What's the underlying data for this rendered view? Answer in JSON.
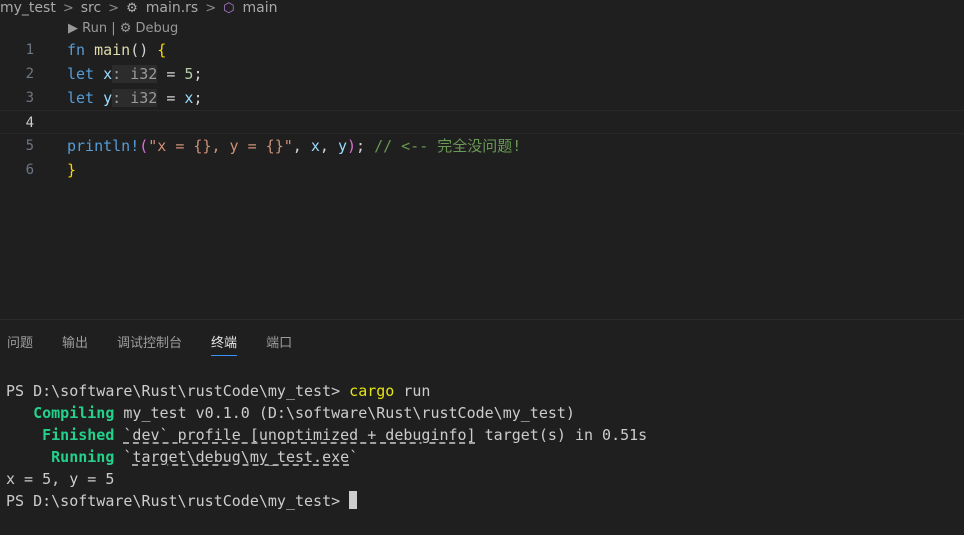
{
  "breadcrumb": {
    "items": [
      "my_test",
      "src",
      "main.rs",
      "main"
    ]
  },
  "codelens": {
    "run": "▶ Run",
    "separator": " | ",
    "debug": "⚙ Debug"
  },
  "editor": {
    "line_numbers": [
      "1",
      "2",
      "3",
      "4",
      "5",
      "6"
    ],
    "lines": [
      [
        {
          "t": "fn",
          "c": "kw"
        },
        {
          "t": " ",
          "c": "plain"
        },
        {
          "t": "main",
          "c": "fn"
        },
        {
          "t": "()",
          "c": "plain"
        },
        {
          "t": " {",
          "c": "brace"
        }
      ],
      [
        {
          "t": "let",
          "c": "kw"
        },
        {
          "t": " ",
          "c": "plain"
        },
        {
          "t": "x",
          "c": "var"
        },
        {
          "t": ": i32",
          "c": "hint"
        },
        {
          "t": " = ",
          "c": "plain"
        },
        {
          "t": "5",
          "c": "num-lit"
        },
        {
          "t": ";",
          "c": "plain"
        }
      ],
      [
        {
          "t": "let",
          "c": "kw"
        },
        {
          "t": " ",
          "c": "plain"
        },
        {
          "t": "y",
          "c": "var"
        },
        {
          "t": ": i32",
          "c": "hint"
        },
        {
          "t": " = ",
          "c": "plain"
        },
        {
          "t": "x",
          "c": "var"
        },
        {
          "t": ";",
          "c": "plain"
        }
      ],
      [],
      [
        {
          "t": "println!",
          "c": "kw"
        },
        {
          "t": "(",
          "c": "brace2"
        },
        {
          "t": "\"x = {}, y = {}\"",
          "c": "str"
        },
        {
          "t": ", ",
          "c": "plain"
        },
        {
          "t": "x",
          "c": "var"
        },
        {
          "t": ", ",
          "c": "plain"
        },
        {
          "t": "y",
          "c": "var"
        },
        {
          "t": ")",
          "c": "brace2"
        },
        {
          "t": "; ",
          "c": "plain"
        },
        {
          "t": "// <-- 完全没问题!",
          "c": "cmt"
        }
      ],
      [
        {
          "t": "}",
          "c": "brace"
        }
      ]
    ],
    "active_line": 4
  },
  "panel": {
    "tabs": [
      "问题",
      "输出",
      "调试控制台",
      "终端",
      "端口"
    ],
    "active_tab": "终端"
  },
  "terminal": {
    "lines": [
      [
        {
          "t": "PS D:\\software\\Rust\\rustCode\\my_test> ",
          "c": ""
        },
        {
          "t": "cargo",
          "c": "t-yellow"
        },
        {
          "t": " run",
          "c": ""
        }
      ],
      [
        {
          "t": "   Compiling",
          "c": "t-green"
        },
        {
          "t": " my_test v0.1.0 (D:\\software\\Rust\\rustCode\\my_test)",
          "c": ""
        }
      ],
      [
        {
          "t": "    Finished",
          "c": "t-green"
        },
        {
          "t": " ",
          "c": ""
        },
        {
          "t": "`dev` profile [unoptimized + debuginfo]",
          "c": "t-ul"
        },
        {
          "t": " target(s) in 0.51s",
          "c": ""
        }
      ],
      [
        {
          "t": "     Running",
          "c": "t-green"
        },
        {
          "t": " `",
          "c": ""
        },
        {
          "t": "target\\debug\\my_test.exe",
          "c": "t-ul"
        },
        {
          "t": "`",
          "c": ""
        }
      ],
      [
        {
          "t": "x = 5, y = 5",
          "c": ""
        }
      ],
      [
        {
          "t": "PS D:\\software\\Rust\\rustCode\\my_test> ",
          "c": ""
        }
      ]
    ]
  }
}
